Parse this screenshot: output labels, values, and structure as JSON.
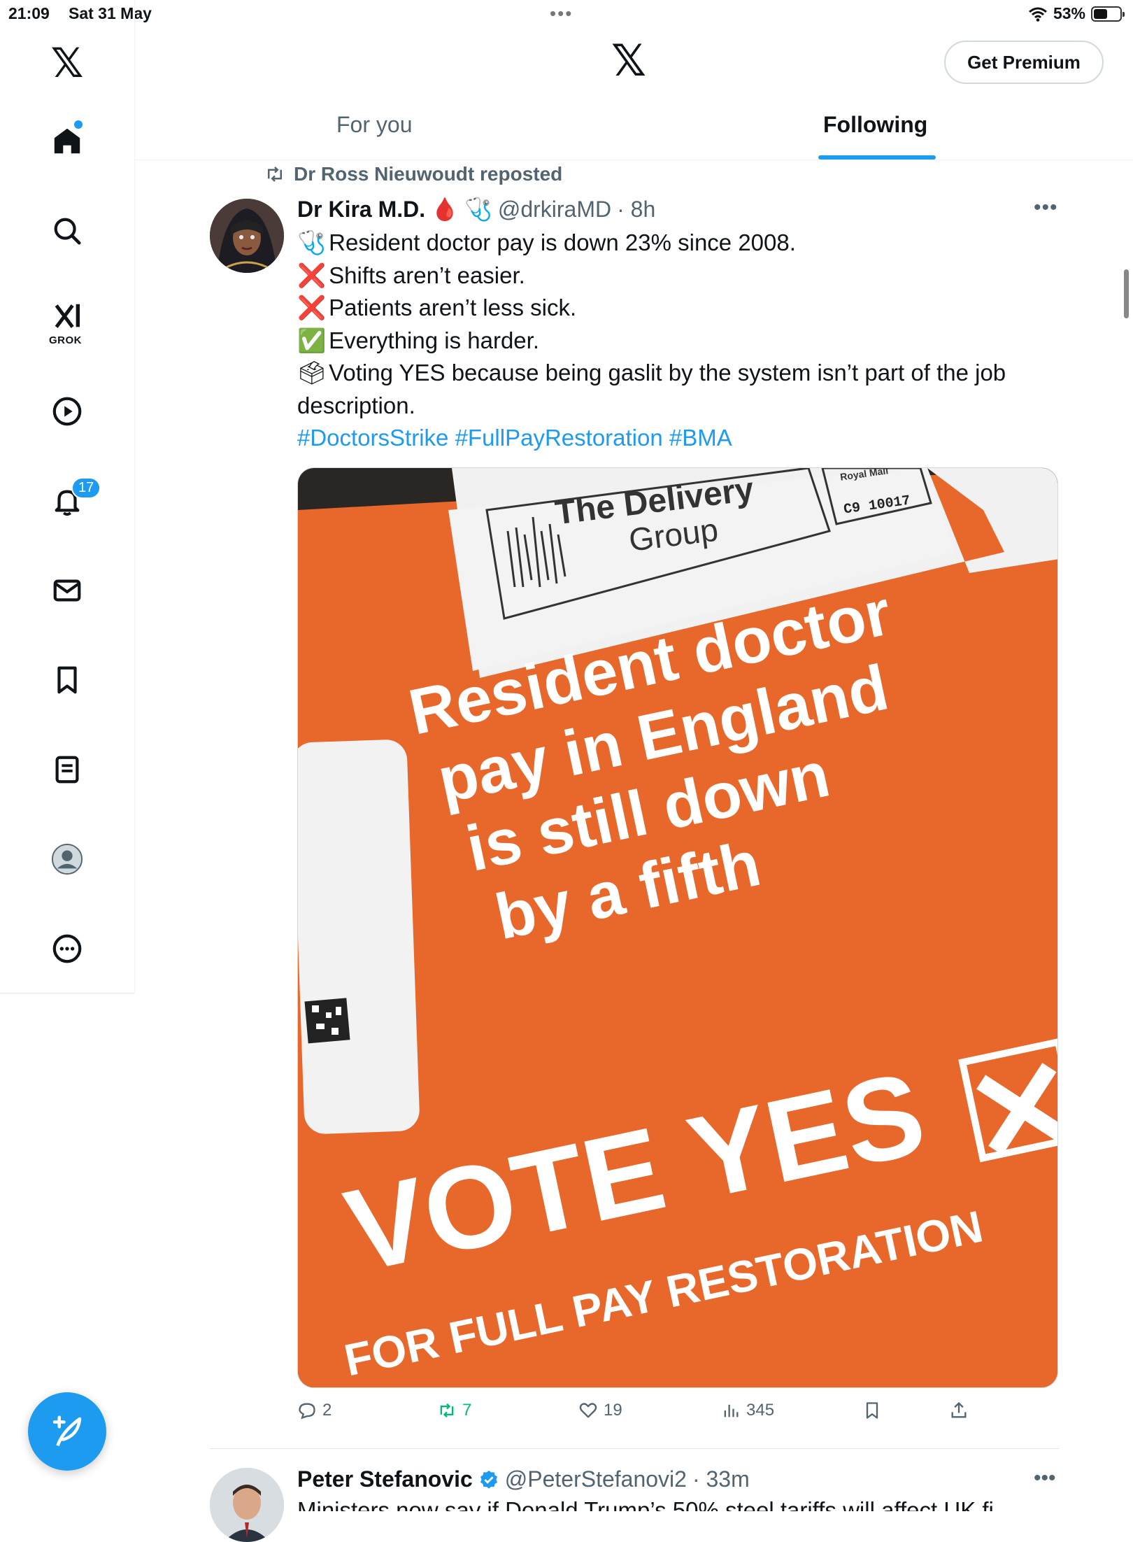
{
  "status_bar": {
    "time": "21:09",
    "date": "Sat 31 May",
    "battery": "53%",
    "battery_level": 0.53
  },
  "sidebar": {
    "logo": "𝕏",
    "grok_label": "GROK",
    "notifications_count": "17",
    "items": [
      {
        "name": "home",
        "icon": "home-icon"
      },
      {
        "name": "explore",
        "icon": "search-icon"
      },
      {
        "name": "grok",
        "icon": "grok-icon"
      },
      {
        "name": "video",
        "icon": "play-icon"
      },
      {
        "name": "notifications",
        "icon": "bell-icon"
      },
      {
        "name": "messages",
        "icon": "mail-icon"
      },
      {
        "name": "bookmarks",
        "icon": "bookmark-icon"
      },
      {
        "name": "lists",
        "icon": "list-icon"
      },
      {
        "name": "profile",
        "icon": "profile-icon"
      },
      {
        "name": "more",
        "icon": "more-circle-icon"
      }
    ]
  },
  "header": {
    "logo": "𝕏",
    "premium_label": "Get Premium",
    "tabs": [
      {
        "label": "For you",
        "active": false
      },
      {
        "label": "Following",
        "active": true
      }
    ]
  },
  "post": {
    "repost_label": "Dr Ross Nieuwoudt reposted",
    "author_name": "Dr Kira M.D.",
    "author_emoji": "🩸",
    "author_emoji2": "🩺",
    "handle": "@drkiraMD",
    "time": "· 8h",
    "lines": [
      {
        "emoji": "🩺",
        "text": "Resident doctor pay is down 23% since 2008."
      },
      {
        "emoji": "❌",
        "text": "Shifts aren’t easier."
      },
      {
        "emoji": "❌",
        "text": "Patients aren’t less sick."
      },
      {
        "emoji": "✅",
        "text": "Everything is harder."
      },
      {
        "emoji": "🗳",
        "text": "Voting YES because being gaslit by the system isn’t part of the job description."
      }
    ],
    "hashtags": "#DoctorsStrike #FullPayRestoration #BMA",
    "image": {
      "company_line1": "The Delivery",
      "company_line2": "Group",
      "royal_mail": "Royal Mail",
      "postcode": "C9 10017",
      "headline_lines": [
        "Resident doctor",
        "pay in England",
        "is still down",
        "by a fifth"
      ],
      "vote_text": "VOTE YES",
      "bottom_text": "FOR FULL PAY RESTORATION",
      "envelope_color": "#e8672a"
    },
    "actions": {
      "replies": "2",
      "reposts": "7",
      "likes": "19",
      "views": "345"
    }
  },
  "post2": {
    "author_name": "Peter Stefanovic",
    "handle": "@PeterStefanovi2",
    "time": "· 33m",
    "text_partial": "Ministers now say if Donald Trump’s 50% steel tariffs will affect UK fi"
  },
  "colors": {
    "accent": "#1d9bf0",
    "repost_green": "#00ba7c",
    "muted": "#536471"
  }
}
